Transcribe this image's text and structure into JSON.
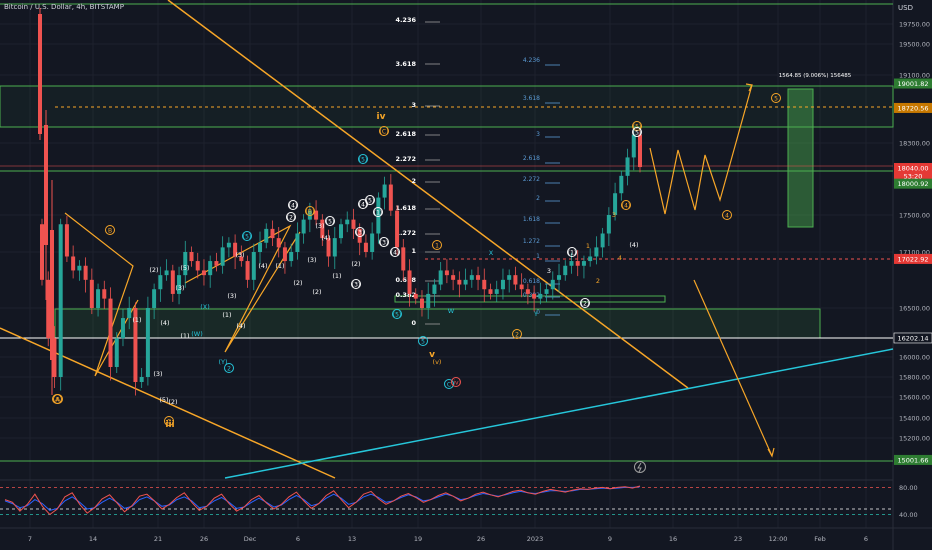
{
  "header": {
    "title": "Bitcoin / U.S. Dollar, 4h, BITSTAMP",
    "currency": "USD"
  },
  "colors": {
    "bg": "#131722",
    "up": "#26a69a",
    "down": "#ef5350",
    "grid": "#1e222d",
    "orange": "#f7a628",
    "green": "#4caf50",
    "teal": "#26c6da",
    "fib_blue": "#5b9bd5",
    "rsi_blue": "#2962ff"
  },
  "chart_data": {
    "type": "candlestick",
    "ylim": [
      15000,
      20000
    ],
    "price_ticks": [
      "19750.00",
      "19500.00",
      "19100.00",
      "18300.00",
      "17500.00",
      "17100.00",
      "16500.00",
      "16000.00",
      "15800.00",
      "15600.00",
      "15400.00",
      "15200.00"
    ],
    "x_ticks": [
      "7",
      "14",
      "21",
      "26",
      "Dec",
      "6",
      "13",
      "19",
      "26",
      "2023",
      "9",
      "16",
      "23",
      "12:00",
      "Feb",
      "6"
    ],
    "price_labels": [
      {
        "text": "19001.82",
        "value": 19001.82,
        "kind": "green"
      },
      {
        "text": "18720.56",
        "value": 18720.56,
        "kind": "orange"
      },
      {
        "text": "18040.00",
        "value": 18040.0,
        "kind": "red"
      },
      {
        "text": "53:20",
        "value": 17950,
        "kind": "red"
      },
      {
        "text": "18000.92",
        "value": 17860,
        "kind": "green"
      },
      {
        "text": "17022.92",
        "value": 17022.92,
        "kind": "red"
      },
      {
        "text": "16202.14",
        "value": 16202.14,
        "kind": "dark"
      },
      {
        "text": "15001.66",
        "value": 15001.66,
        "kind": "green"
      }
    ],
    "candles_path": [
      16800,
      16200,
      15800,
      17400,
      17050,
      16900,
      16950,
      16800,
      16500,
      16700,
      16600,
      15900,
      16200,
      16400,
      16500,
      15750,
      15800,
      16500,
      16700,
      16850,
      16900,
      16650,
      16850,
      17100,
      17000,
      16900,
      16850,
      17000,
      16950,
      17150,
      17200,
      17050,
      17000,
      16800,
      17100,
      17200,
      17350,
      17250,
      17150,
      17000,
      17100,
      17300,
      17450,
      17550,
      17450,
      17250,
      17050,
      17250,
      17400,
      17450,
      17350,
      17200,
      17100,
      17300,
      17700,
      17850,
      17550,
      17150,
      16900,
      16650,
      16600,
      16500,
      16650,
      16750,
      16900,
      16850,
      16800,
      16750,
      16800,
      16850,
      16800,
      16700,
      16650,
      16700,
      16800,
      16850,
      16750,
      16700,
      16650,
      16600,
      16650,
      16700,
      16800,
      16850,
      16950,
      17000,
      16950,
      17000,
      17050,
      17150,
      17300,
      17500,
      17750,
      17950,
      18150,
      18400,
      18050
    ],
    "fib_left": [
      "4.236",
      "3.618",
      "3",
      "2.618",
      "2.272",
      "2",
      "1.618",
      "1.272",
      "1",
      "0.618",
      "0.382",
      "0"
    ],
    "fib_mid": [
      "4.236",
      "3.618",
      "3",
      "2.618",
      "2.272",
      "2",
      "1.618",
      "1.272",
      "1",
      "0.618",
      "0.382",
      "0"
    ],
    "measure_label": "1564.85 (9.006%) 156485",
    "wave_labels_orange": [
      "B",
      "A",
      "iii",
      "iv",
      "v",
      "(v)",
      "(C)",
      "(B)",
      "(5)",
      "(4)",
      "3",
      "2",
      "1",
      "4"
    ],
    "wave_labels_teal": [
      "(5)",
      "(4)",
      "(3)",
      "(2)",
      "(1)",
      "(W)",
      "(Y)",
      "W",
      "X",
      "Y",
      "C"
    ],
    "wave_labels_white": [
      "(1)",
      "(2)",
      "(3)",
      "(4)",
      "(5)",
      "(2)",
      "(4)",
      "(1)",
      "(2)",
      "(3)",
      "(4)",
      "(5)",
      "1",
      "2",
      "3",
      "4"
    ],
    "wave_labels_orange_circle": [
      "1",
      "2",
      "3",
      "4",
      "5",
      "A",
      "B",
      "C"
    ],
    "wave_labels_red_circle": [
      "(iv)"
    ],
    "rsi": {
      "levels": [
        "80.00",
        "40.00"
      ],
      "series_red": [
        62,
        58,
        45,
        55,
        70,
        52,
        40,
        48,
        66,
        72,
        55,
        42,
        50,
        63,
        69,
        57,
        44,
        53,
        67,
        70,
        60,
        48,
        55,
        65,
        72,
        58,
        46,
        52,
        64,
        70,
        56,
        45,
        51,
        62,
        68,
        57,
        48,
        55,
        66,
        73,
        60,
        49,
        56,
        68,
        75,
        62,
        50,
        58,
        70,
        74,
        63,
        55,
        60,
        67,
        71,
        65,
        58,
        62,
        68,
        72,
        67,
        60,
        64,
        70,
        73,
        69,
        66,
        70,
        74,
        76,
        72,
        70,
        74,
        77,
        75,
        73,
        76,
        78,
        77,
        79,
        80,
        78,
        80,
        81,
        79,
        82
      ],
      "series_blue": [
        60,
        56,
        50,
        53,
        62,
        56,
        46,
        49,
        60,
        66,
        58,
        48,
        50,
        58,
        64,
        58,
        49,
        52,
        62,
        66,
        60,
        52,
        54,
        62,
        66,
        60,
        50,
        52,
        60,
        65,
        58,
        49,
        51,
        58,
        64,
        58,
        51,
        54,
        62,
        68,
        62,
        53,
        56,
        64,
        70,
        64,
        55,
        58,
        66,
        70,
        65,
        58,
        60,
        65,
        69,
        66,
        60,
        62,
        66,
        70,
        67,
        62,
        64,
        68,
        71,
        69,
        67,
        69,
        72,
        74,
        72,
        71,
        73,
        75,
        75,
        74,
        75,
        77,
        77,
        78,
        79,
        78,
        79,
        80,
        80,
        81
      ]
    }
  }
}
